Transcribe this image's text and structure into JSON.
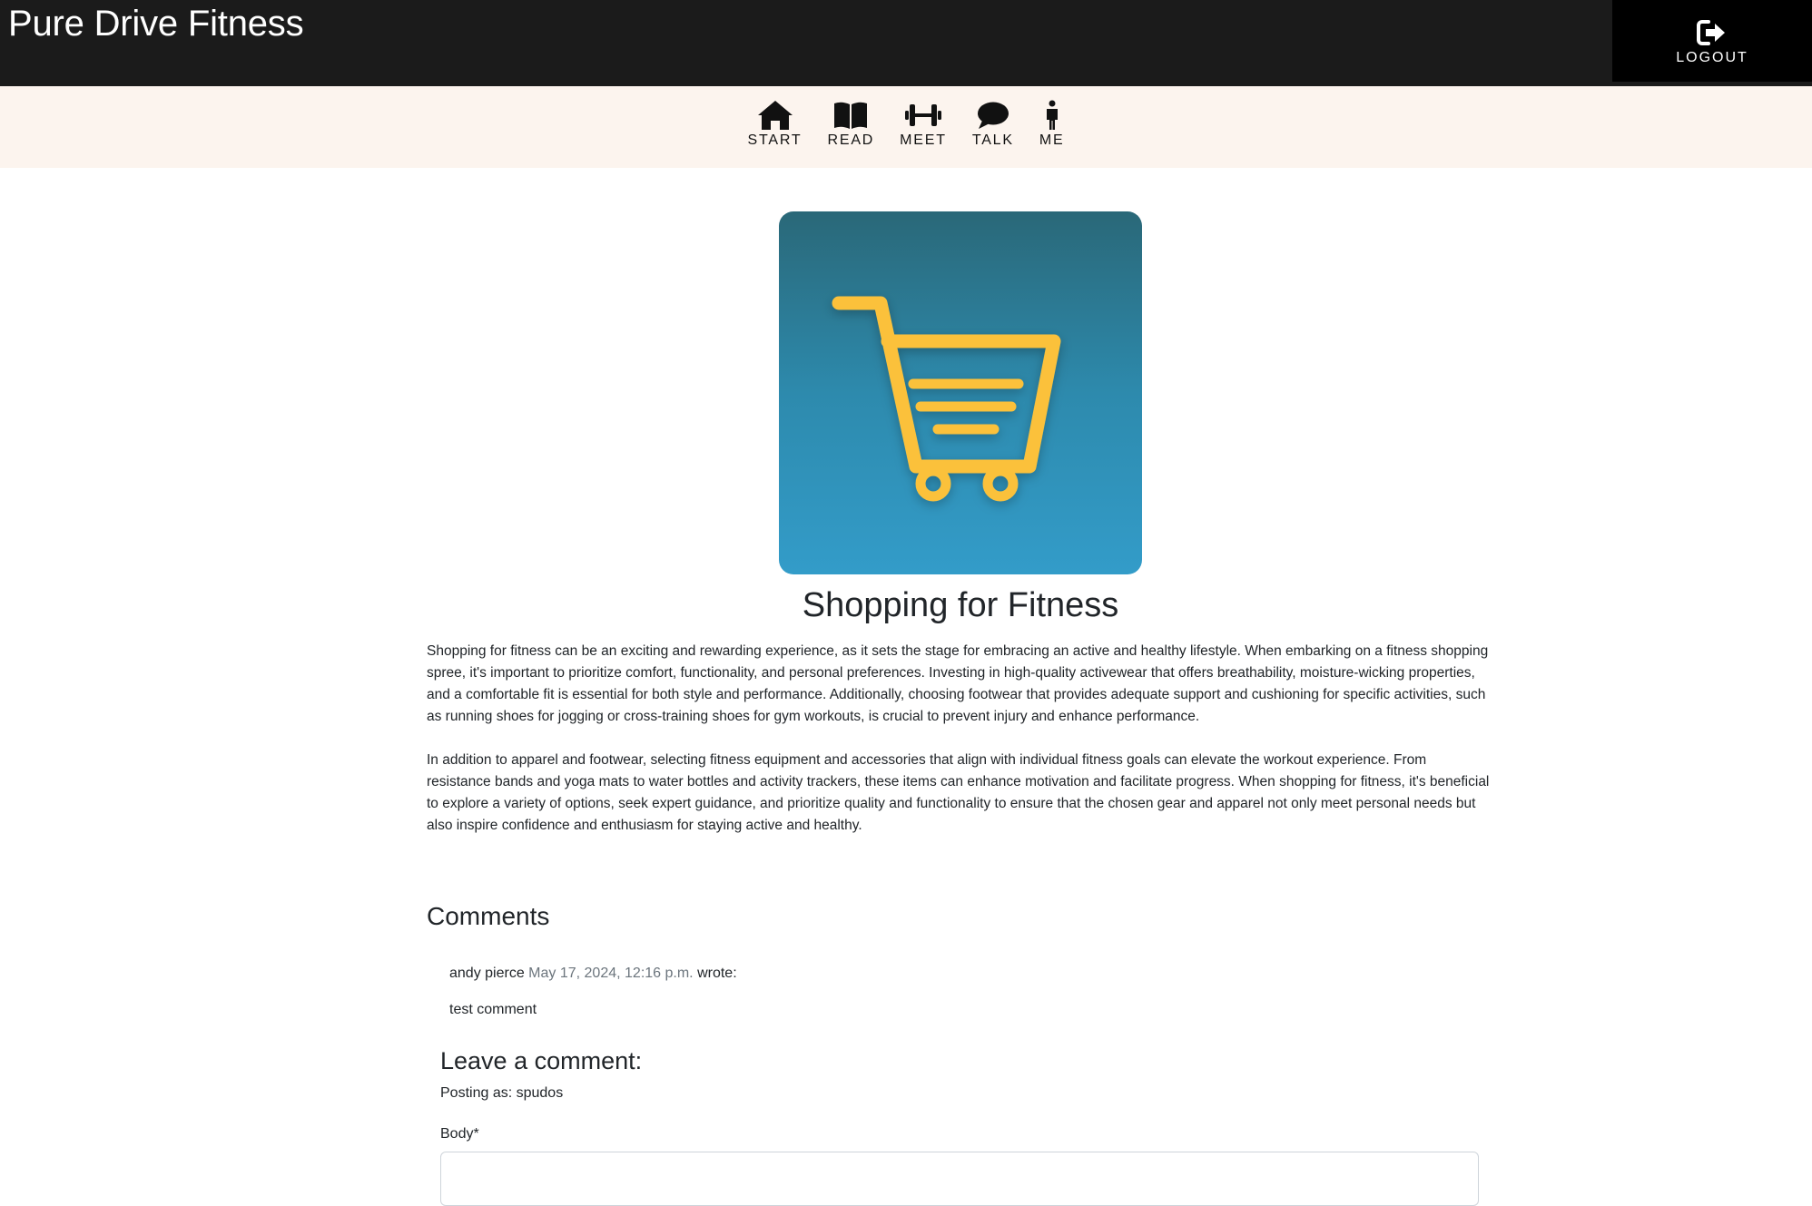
{
  "header": {
    "brand": "Pure Drive Fitness",
    "logout_label": "LOGOUT"
  },
  "nav": {
    "items": [
      {
        "label": "START",
        "icon": "home-icon"
      },
      {
        "label": "READ",
        "icon": "book-icon"
      },
      {
        "label": "MEET",
        "icon": "dumbbell-icon"
      },
      {
        "label": "TALK",
        "icon": "speech-bubble-icon"
      },
      {
        "label": "ME",
        "icon": "person-icon"
      }
    ]
  },
  "post": {
    "image_icon": "shopping-cart-icon",
    "title": "Shopping for Fitness",
    "paragraphs": [
      "Shopping for fitness can be an exciting and rewarding experience, as it sets the stage for embracing an active and healthy lifestyle. When embarking on a fitness shopping spree, it's important to prioritize comfort, functionality, and personal preferences. Investing in high-quality activewear that offers breathability, moisture-wicking properties, and a comfortable fit is essential for both style and performance. Additionally, choosing footwear that provides adequate support and cushioning for specific activities, such as running shoes for jogging or cross-training shoes for gym workouts, is crucial to prevent injury and enhance performance.",
      "In addition to apparel and footwear, selecting fitness equipment and accessories that align with individual fitness goals can elevate the workout experience. From resistance bands and yoga mats to water bottles and activity trackers, these items can enhance motivation and facilitate progress. When shopping for fitness, it's beneficial to explore a variety of options, seek expert guidance, and prioritize quality and functionality to ensure that the chosen gear and apparel not only meet personal needs but also inspire confidence and enthusiasm for staying active and healthy."
    ]
  },
  "comments": {
    "heading": "Comments",
    "items": [
      {
        "author": "andy pierce",
        "date": "May 17, 2024, 12:16 p.m.",
        "wrote": "wrote:",
        "body": "test comment"
      }
    ]
  },
  "comment_form": {
    "heading": "Leave a comment:",
    "posting_as": "Posting as: spudos",
    "body_label": "Body*"
  },
  "colors": {
    "topbar": "#1b1b1b",
    "navbar": "#fcf4ee",
    "cart": "#fbc13b",
    "muted": "#6c757d"
  }
}
